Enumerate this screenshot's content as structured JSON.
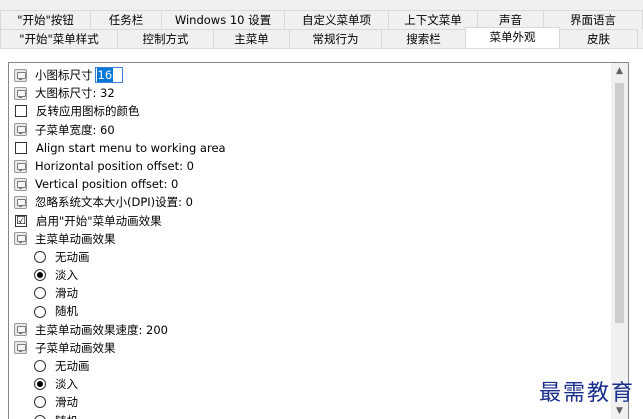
{
  "tabs_row1": [
    {
      "label": "\"开始\"按钮",
      "w": 0
    },
    {
      "label": "任务栏"
    },
    {
      "label": "Windows 10 设置"
    },
    {
      "label": "自定义菜单项"
    },
    {
      "label": "上下文菜单"
    },
    {
      "label": "声音"
    },
    {
      "label": "界面语言"
    }
  ],
  "tabs_row2": [
    {
      "label": "\"开始\"菜单样式"
    },
    {
      "label": "控制方式"
    },
    {
      "label": "主菜单"
    },
    {
      "label": "常规行为"
    },
    {
      "label": "搜索栏"
    },
    {
      "label": "菜单外观",
      "active": true
    },
    {
      "label": "皮肤"
    }
  ],
  "settings": {
    "small_icon_label": "小图标尺寸",
    "small_icon_value": "16",
    "large_icon": "大图标尺寸: 32",
    "invert_icons": "反转应用图标的颜色",
    "submenu_width": "子菜单宽度: 60",
    "align_working_area": "Align start menu to working area",
    "h_offset": "Horizontal position offset: 0",
    "v_offset": "Vertical position offset: 0",
    "ignore_dpi": "忽略系统文本大小(DPI)设置: 0",
    "enable_animation": "启用\"开始\"菜单动画效果",
    "main_anim": "主菜单动画效果",
    "main_opt_none": "无动画",
    "main_opt_fade": "淡入",
    "main_opt_slide": "滑动",
    "main_opt_random": "随机",
    "main_anim_speed": "主菜单动画效果速度: 200",
    "sub_anim": "子菜单动画效果",
    "sub_opt_none": "无动画",
    "sub_opt_fade": "淡入",
    "sub_opt_slide": "滑动",
    "sub_opt_random": "随机"
  },
  "checkmark": "☑",
  "scroll": {
    "up": "▲",
    "down": "▼"
  },
  "watermark": "最需教育"
}
